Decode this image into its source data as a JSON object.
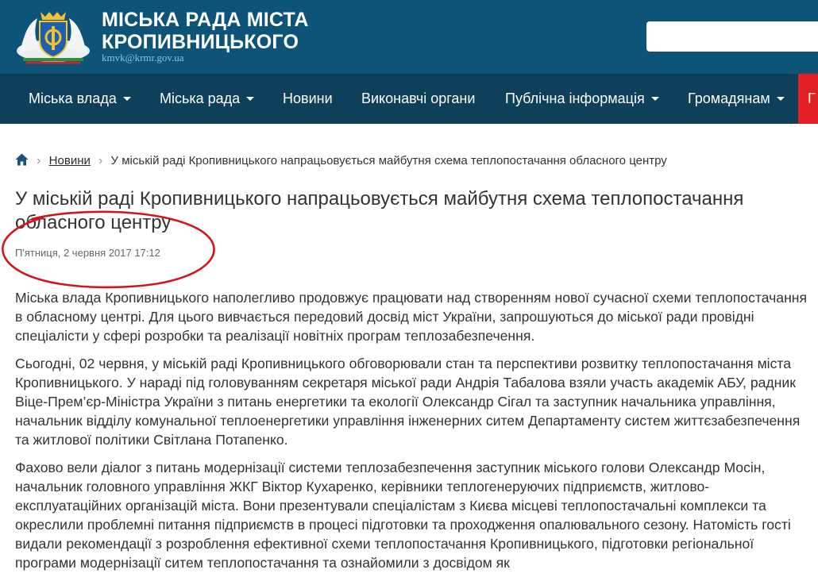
{
  "header": {
    "title_line1": "Міська рада міста",
    "title_line2": "Кропивницького",
    "email": "kmvk@krmr.gov.ua",
    "search_placeholder": ""
  },
  "nav": {
    "items": [
      {
        "label": "Міська влада",
        "dropdown": true
      },
      {
        "label": "Міська рада",
        "dropdown": true
      },
      {
        "label": "Новини",
        "dropdown": false
      },
      {
        "label": "Виконавчі органи",
        "dropdown": false
      },
      {
        "label": "Публічна інформація",
        "dropdown": true
      },
      {
        "label": "Громадянам",
        "dropdown": true
      }
    ],
    "cut_item_label": "Г"
  },
  "breadcrumb": {
    "home_icon": "home-icon",
    "news": "Новини",
    "current": "У міській раді Кропивницького напрацьовується майбутня схема теплопостачання обласного центру"
  },
  "article": {
    "title": "У міській раді Кропивницького напрацьовується майбутня схема теплопостачання обласного центру",
    "date": "П'ятниця, 2 червня 2017 17:12",
    "paragraphs": [
      "Міська влада Кропивницького наполегливо продовжує працювати над створенням нової сучасної схеми теплопостачання в обласному центрі. Для цього вивчається передовий досвід міст України, запрошуються до міської ради провідні спеціалісти у сфері розробки та реалізації новітніх програм теплозабезпечення.",
      "Сьогодні, 02 червня, у міській раді Кропивницького обговорювали стан та перспективи розвитку теплопостачання міста Кропивницького. У нараді під головуванням секретаря міської ради Андрія Табалова взяли участь академік АБУ, радник Віце-Прем’єр-Міністра України з питань енергетики та екології Олександр Сігал та заступник начальника управління, начальник відділу комунальної теплоенергетики управління інженерних ситем Департаменту систем життєзабезпечення та житлової політики Світлана Потапенко.",
      "Фахово вели діалог з питань модернізації системи теплозабезпечення заступник міського голови Олександр Мосін, начальник головного управління ЖКГ Віктор Кухаренко, керівники теплогенеруючих підприємств, житлово-експлуатаційних організацій міста. Вони презентували спеціалістам з Києва місцеві теплопостачальні комплекси та окреслили проблемні питання підприємств в процесі підготовки та проходження опалювального сезону. Натомість гості видали рекомендації з розроблення ефективної схеми теплопостачання Кропивницького, підготовки регіональної програми модернізації ситем теплопостачання та ознайомили з досвідом як"
    ]
  },
  "colors": {
    "header_bg": "#0d5478",
    "nav_bg": "#0e3f5b",
    "nav_accent": "#e31e24",
    "annotation_ellipse": "#d0161c"
  }
}
